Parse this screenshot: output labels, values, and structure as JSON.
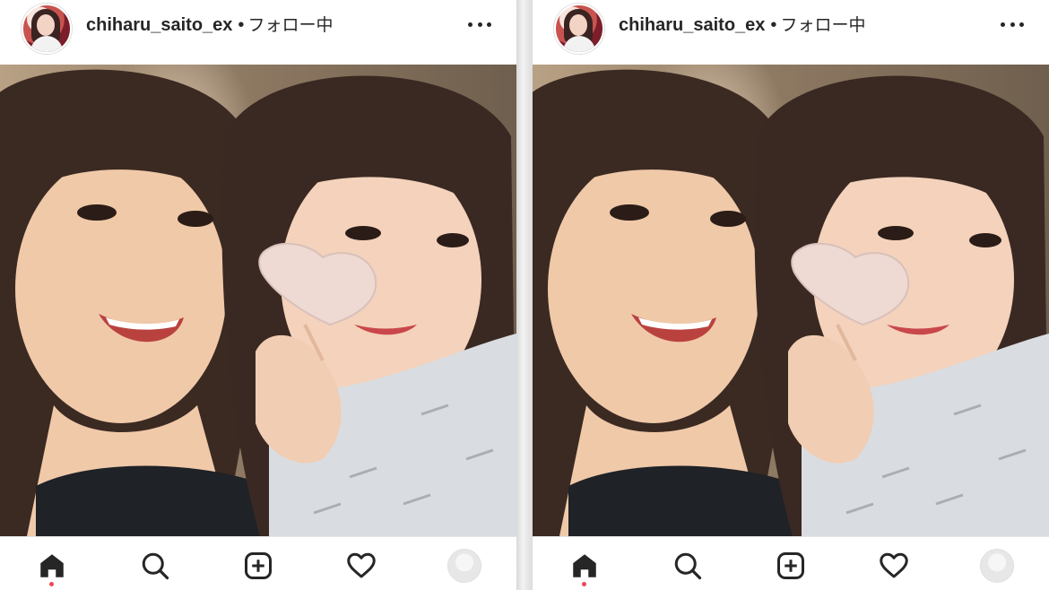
{
  "panels": [
    {
      "username": "chiharu_saito_ex",
      "separator": "•",
      "follow_status": "フォロー中",
      "icons": {
        "more": "more-options-icon",
        "home": "home-icon",
        "search": "search-icon",
        "add": "add-post-icon",
        "activity": "heart-icon",
        "profile": "profile-avatar-icon"
      }
    },
    {
      "username": "chiharu_saito_ex",
      "separator": "•",
      "follow_status": "フォロー中",
      "icons": {
        "more": "more-options-icon",
        "home": "home-icon",
        "search": "search-icon",
        "add": "add-post-icon",
        "activity": "heart-icon",
        "profile": "profile-avatar-icon"
      }
    }
  ],
  "colors": {
    "text": "#262626",
    "notification_dot": "#ed4956",
    "background": "#ffffff"
  }
}
